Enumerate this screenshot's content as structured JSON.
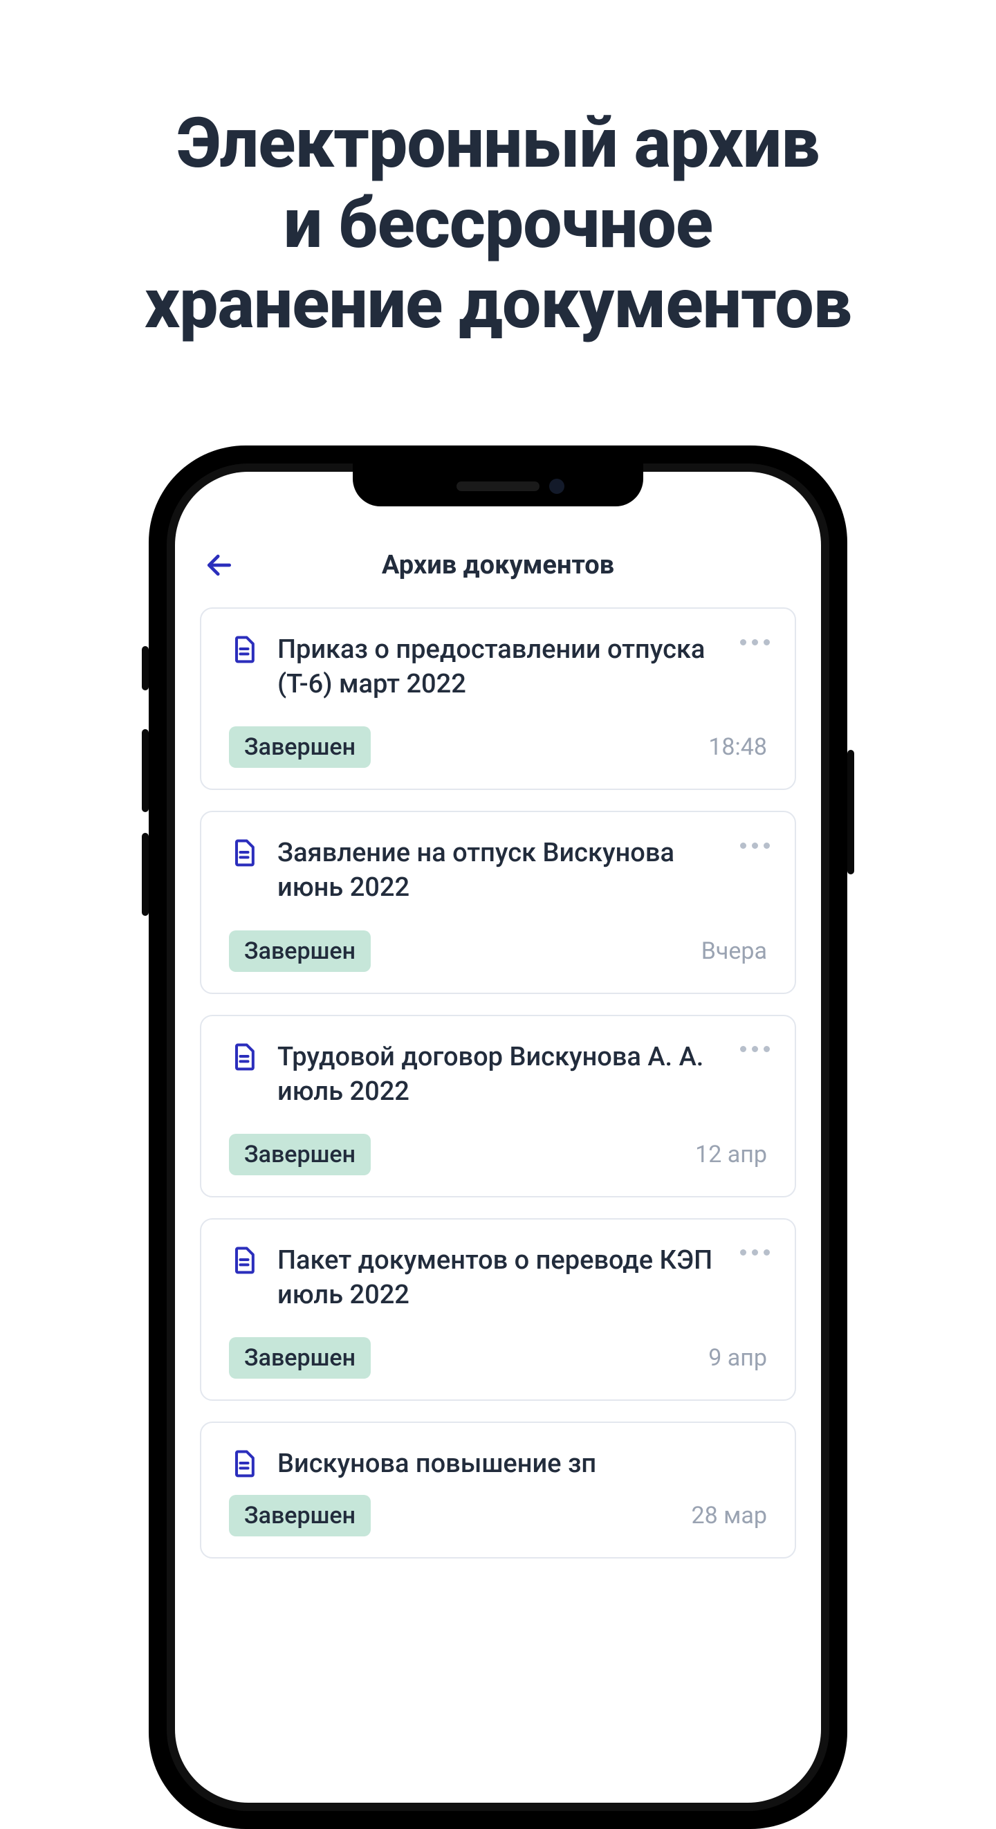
{
  "headline": {
    "line1": "Электронный архив",
    "line2": "и бессрочное",
    "line3": "хранение документов"
  },
  "app": {
    "title": "Архив документов"
  },
  "documents": [
    {
      "title": "Приказ о предоставлении отпуска (Т-6) март 2022",
      "status": "Завершен",
      "time": "18:48"
    },
    {
      "title": "Заявление на отпуск Вискунова июнь 2022",
      "status": "Завершен",
      "time": "Вчера"
    },
    {
      "title": "Трудовой договор Вискунова А. А. июль 2022",
      "status": "Завершен",
      "time": "12 апр"
    },
    {
      "title": "Пакет документов о переводе КЭП июль 2022",
      "status": "Завершен",
      "time": "9 апр"
    },
    {
      "title": "Вискунова повышение зп",
      "status": "Завершен",
      "time": "28 мар"
    }
  ]
}
